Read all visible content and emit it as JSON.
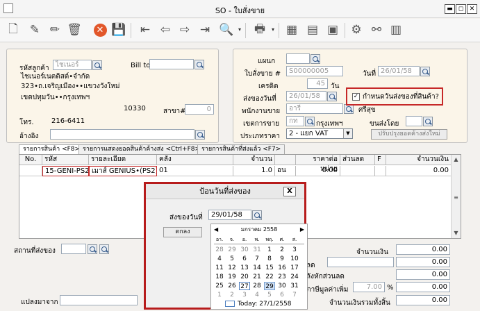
{
  "window": {
    "title": "SO - ใบสั่งขาย",
    "minimize": "▬",
    "maximize": "◻",
    "close": "✕"
  },
  "customer_panel": {
    "code_label": "รหัสลูกค้า",
    "code_value": "ไชเนอร์",
    "bill_to_label": "Bill to",
    "bill_to_value": "",
    "name": "ไชเนอร์เนตติสต์•จำกัด",
    "address1": "323•ถ.เจริญเมือง••แขวงวังใหม่",
    "address2": "เขตปทุมวัน••กรุงเทพฯ",
    "postcode": "10330",
    "branch_label": "สาขา#",
    "branch_value": "0",
    "phone_label": "โทร.",
    "phone_value": "216-6411",
    "ref_label": "อ้างอิง",
    "ref_value": ""
  },
  "order_panel": {
    "dept_label": "แผนก",
    "dept_value": "",
    "so_label": "ใบสั่งขาย #",
    "so_value": "S00000005",
    "date_label": "วันที่",
    "date_value": "26/01/58",
    "credit_label": "เครดิต",
    "credit_value": "45",
    "credit_unit": "วัน",
    "ship_date_label": "ส่งของวันที่",
    "ship_date_value": "26/01/58",
    "ship_check_label": "กำหนดวันส่งของที่สินค้า?",
    "ship_check_mark": "✓",
    "staff_label": "พนักงานขาย",
    "staff_value": "อารี",
    "sukhum": "ศรีสุข",
    "area_label": "เขตการขาย",
    "area_code": "กท",
    "area_name": "กรุงเทพฯ",
    "ship_by_label": "ขนส่งโดย",
    "ship_by_value": "",
    "price_label": "ประเภทราคา",
    "price_value": "2 - แยก VAT",
    "update_button": "ปรับปรุงยอดค้างส่งใหม่"
  },
  "tabs": [
    {
      "label": "รายการสินค้า <F8>"
    },
    {
      "label": "รายการแสดงยอดสินค้าค้างส่ง <Ctrl+F8>"
    },
    {
      "label": "รายการสินค้าที่ส่งแล้ว <F7>"
    }
  ],
  "grid": {
    "headers": [
      "No.",
      "รหัส",
      "รายละเอียด",
      "คลัง",
      "จำนวน",
      "",
      "ราคาต่อหน่วย",
      "ส่วนลด",
      "F",
      "จำนวนเงิน"
    ],
    "rows": [
      {
        "no": "",
        "code": "15-GENI-PS2",
        "desc": "เมาส์ GENIUS•(PS2)",
        "wh": "01",
        "qty": "1.0",
        "unit": "อน",
        "price": "0.00",
        "disc": "",
        "f": "",
        "amount": "0.00"
      }
    ]
  },
  "footer": {
    "status_label": "สถานที่ส่งของ",
    "status_value": "",
    "remark_label": "แปลงมาจาก",
    "remark_value": "",
    "amount_label": "จำนวนเงิน",
    "amount_value": "0.00",
    "discount_label": "ลด",
    "discount_input": "",
    "discount_value": "0.00",
    "after_disc_label": "ลังหักส่วนลด",
    "after_disc_value": "0.00",
    "vat_label": "ภาษีมูลค่าเพิ่ม",
    "vat_rate": "7.00",
    "vat_pct": "%",
    "vat_value": "0.00",
    "total_label": "จำนวนเงินรวมทั้งสิ้น",
    "total_value": "0.00"
  },
  "dialog": {
    "title": "ป้อนวันที่ส่งของ",
    "close": "X",
    "date_label": "ส่งของวันที่",
    "date_value": "29/01/58",
    "ok_button": "ตกลง",
    "calendar": {
      "month_label": "มกราคม 2558",
      "prev": "◀",
      "next": "▶",
      "weekdays": [
        "อา.",
        "จ.",
        "อ.",
        "พ.",
        "พฤ.",
        "ศ.",
        "ส."
      ],
      "days": [
        [
          "28",
          "29",
          "30",
          "31",
          "1",
          "2",
          "3"
        ],
        [
          "4",
          "5",
          "6",
          "7",
          "8",
          "9",
          "10"
        ],
        [
          "11",
          "12",
          "13",
          "14",
          "15",
          "16",
          "17"
        ],
        [
          "18",
          "19",
          "20",
          "21",
          "22",
          "23",
          "24"
        ],
        [
          "25",
          "26",
          "27",
          "28",
          "29",
          "30",
          "31"
        ],
        [
          "1",
          "2",
          "3",
          "4",
          "5",
          "6",
          "7"
        ]
      ],
      "today_label": "Today: 27/1/2558"
    }
  }
}
